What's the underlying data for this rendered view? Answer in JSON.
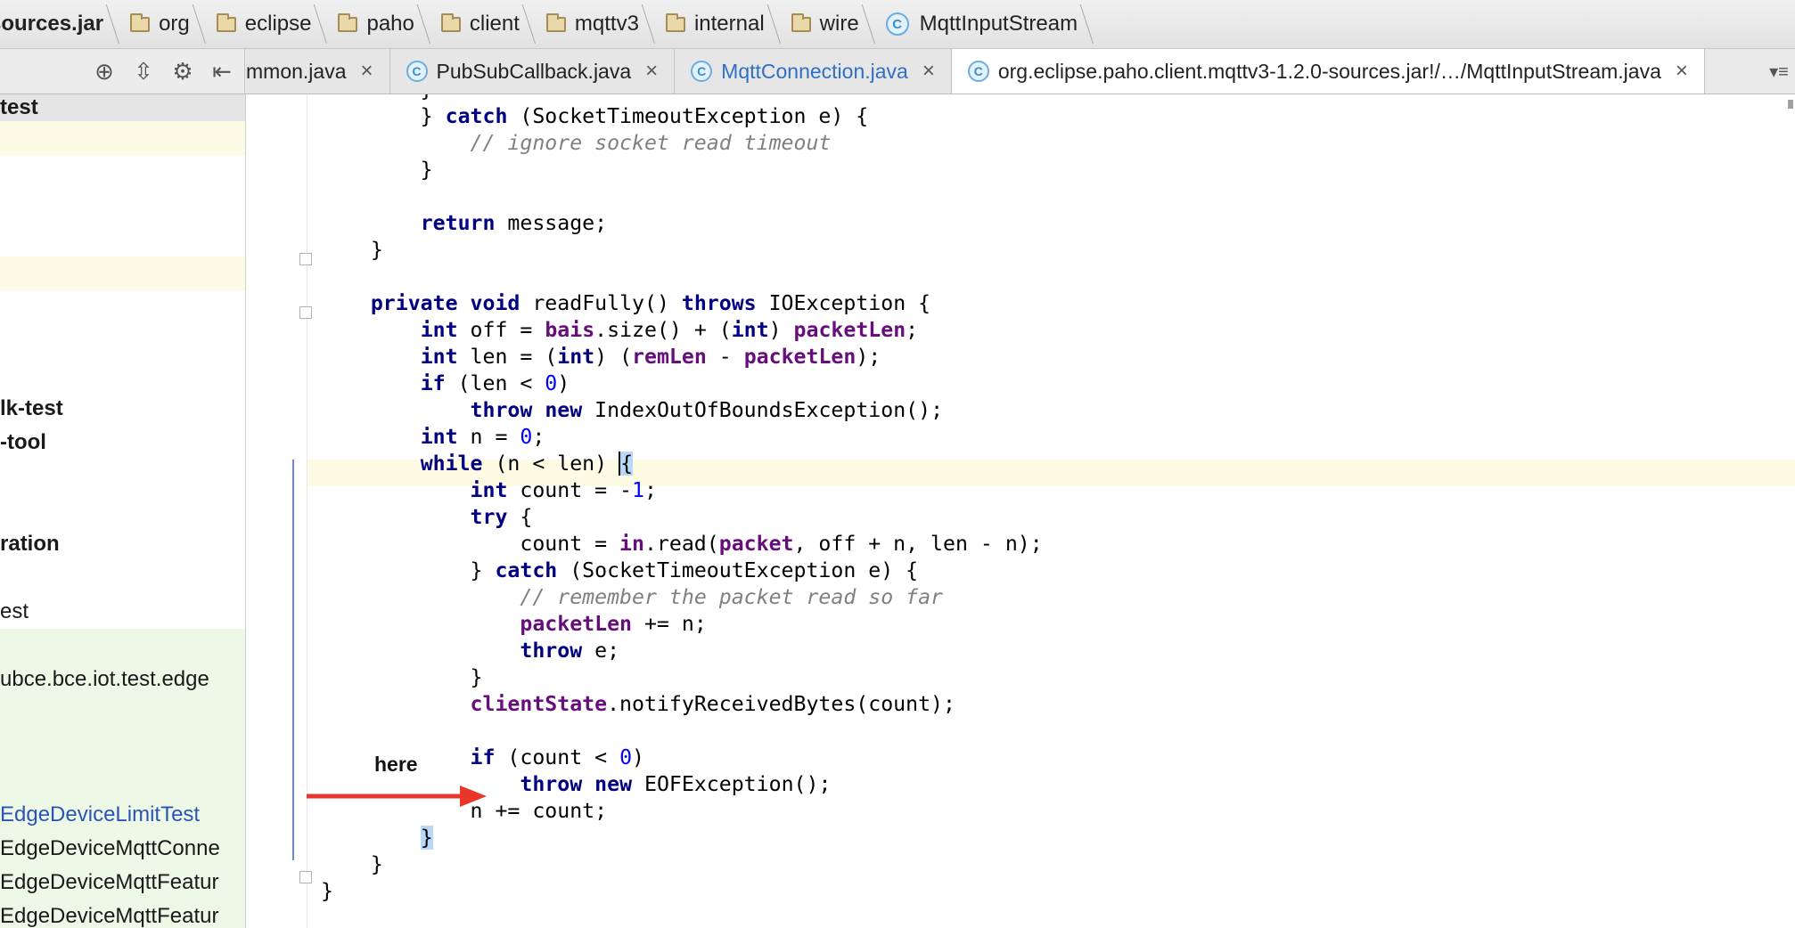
{
  "breadcrumb": {
    "items": [
      {
        "label": "sources.jar",
        "icon": "jar"
      },
      {
        "label": "org",
        "icon": "folder-icon"
      },
      {
        "label": "eclipse",
        "icon": "folder-icon"
      },
      {
        "label": "paho",
        "icon": "folder-icon"
      },
      {
        "label": "client",
        "icon": "folder-icon"
      },
      {
        "label": "mqttv3",
        "icon": "folder-icon"
      },
      {
        "label": "internal",
        "icon": "folder-icon"
      },
      {
        "label": "wire",
        "icon": "folder-icon"
      },
      {
        "label": "MqttInputStream",
        "icon": "class-icon",
        "glyph": "C"
      }
    ]
  },
  "toolbar": {
    "icons": [
      "crosshair-icon",
      "collapse-icon",
      "gear-icon",
      "hide-icon"
    ],
    "glyphs": {
      "crosshair": "⊕",
      "collapse": "⇳",
      "gear": "⚙",
      "hide": "⇤"
    }
  },
  "tabs": [
    {
      "label": "mmon.java",
      "close": "×",
      "partial": true
    },
    {
      "label": "PubSubCallback.java",
      "close": "×",
      "icon": "C"
    },
    {
      "label": "MqttConnection.java",
      "close": "×",
      "icon": "C",
      "blue": true
    },
    {
      "label": "org.eclipse.paho.client.mqttv3-1.2.0-sources.jar!/…/MqttInputStream.java",
      "close": "×",
      "icon": "C",
      "active": true
    }
  ],
  "tab_overflow": "▾≡",
  "project_tree": {
    "rows": [
      {
        "label": "test",
        "style": "bold"
      },
      {
        "label": "lk-test",
        "style": "bold"
      },
      {
        "label": "-tool",
        "style": "bold"
      },
      {
        "label": "ration",
        "style": "bold"
      },
      {
        "label": "est",
        "style": "normal"
      },
      {
        "label": "ubce.bce.iot.test.edge",
        "style": "normal"
      },
      {
        "label": "EdgeDeviceLimitTest",
        "style": "link"
      },
      {
        "label": "EdgeDeviceMqttConne",
        "style": "normal"
      },
      {
        "label": "EdgeDeviceMqttFeatur",
        "style": "normal"
      },
      {
        "label": "EdgeDeviceMqttFeatur",
        "style": "normal"
      }
    ]
  },
  "code": {
    "lines": [
      "        }",
      "        } catch (SocketTimeoutException e) {",
      "            // ignore socket read timeout",
      "        }",
      "",
      "        return message;",
      "    }",
      "",
      "    private void readFully() throws IOException {",
      "        int off = bais.size() + (int) packetLen;",
      "        int len = (int) (remLen - packetLen);",
      "        if (len < 0)",
      "            throw new IndexOutOfBoundsException();",
      "        int n = 0;",
      "        while (n < len) {",
      "            int count = -1;",
      "            try {",
      "                count = in.read(packet, off + n, len - n);",
      "            } catch (SocketTimeoutException e) {",
      "                // remember the packet read so far",
      "                packetLen += n;",
      "                throw e;",
      "            }",
      "            clientState.notifyReceivedBytes(count);",
      "",
      "            if (count < 0)",
      "                throw new EOFException();",
      "            n += count;",
      "        }",
      "    }",
      "}"
    ],
    "keywords": [
      "catch",
      "return",
      "private",
      "void",
      "throws",
      "int",
      "if",
      "throw",
      "new",
      "while",
      "try"
    ],
    "fields": [
      "bais",
      "packetLen",
      "remLen",
      "in",
      "packet",
      "clientState"
    ]
  },
  "annotation": {
    "label": "here",
    "arrow_color": "#e8372a"
  }
}
